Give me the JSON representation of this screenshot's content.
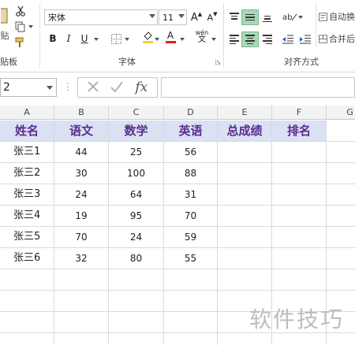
{
  "ribbon": {
    "clipboard": {
      "paste_label": "贴",
      "group_label": "贴板"
    },
    "font": {
      "font_name": "宋体",
      "font_size": "11",
      "bold": "B",
      "italic": "I",
      "underline": "U",
      "grow_font": "A",
      "shrink_font": "A",
      "font_color_glyph": "A",
      "phonetic_glyph": "wén",
      "group_label": "字体"
    },
    "alignment": {
      "wrap_text_label": "自动换",
      "merge_label": "合并后",
      "group_label": "对齐方式"
    }
  },
  "formula_bar": {
    "name_box": "2",
    "fx": "fx",
    "formula": ""
  },
  "sheet": {
    "columns": [
      "A",
      "B",
      "C",
      "D",
      "E",
      "F",
      "G"
    ],
    "headers": [
      "姓名",
      "语文",
      "数学",
      "英语",
      "总成绩",
      "排名"
    ],
    "rows": [
      [
        "张三1",
        "44",
        "25",
        "56",
        "",
        ""
      ],
      [
        "张三2",
        "30",
        "100",
        "88",
        "",
        ""
      ],
      [
        "张三3",
        "24",
        "64",
        "31",
        "",
        ""
      ],
      [
        "张三4",
        "19",
        "95",
        "70",
        "",
        ""
      ],
      [
        "张三5",
        "70",
        "24",
        "59",
        "",
        ""
      ],
      [
        "张三6",
        "32",
        "80",
        "55",
        "",
        ""
      ]
    ]
  },
  "watermark": "软件技巧",
  "colors": {
    "header_fill": "#d9e1f2",
    "header_text": "#5a2b8e",
    "align_active": "#a9d8b8"
  }
}
